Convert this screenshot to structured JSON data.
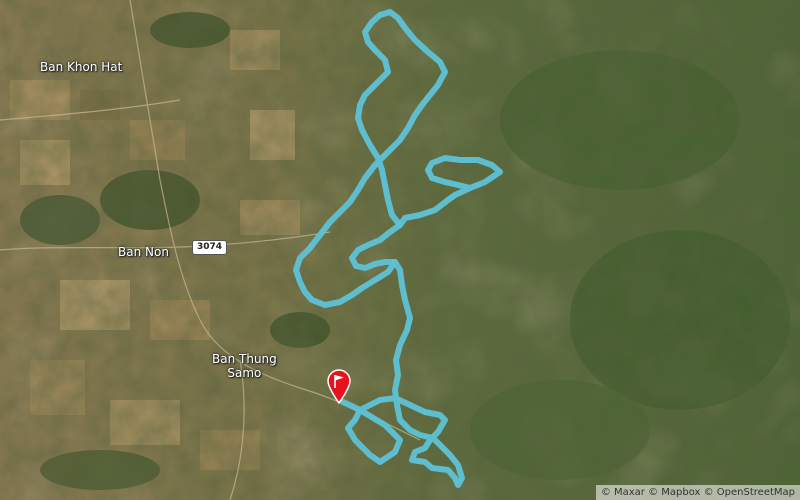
{
  "map": {
    "imagery": "satellite",
    "places": {
      "ban_khon_hat": "Ban Khon Hat",
      "ban_non": "Ban Non",
      "ban_thung_samo": "Ban Thung\nSamo"
    },
    "road_shield": "3074",
    "attribution": "© Maxar © Mapbox © OpenStreetMap",
    "route_color": "#5ec2d6",
    "marker_color": "#e8121f",
    "marker_icon": "flag-icon"
  }
}
